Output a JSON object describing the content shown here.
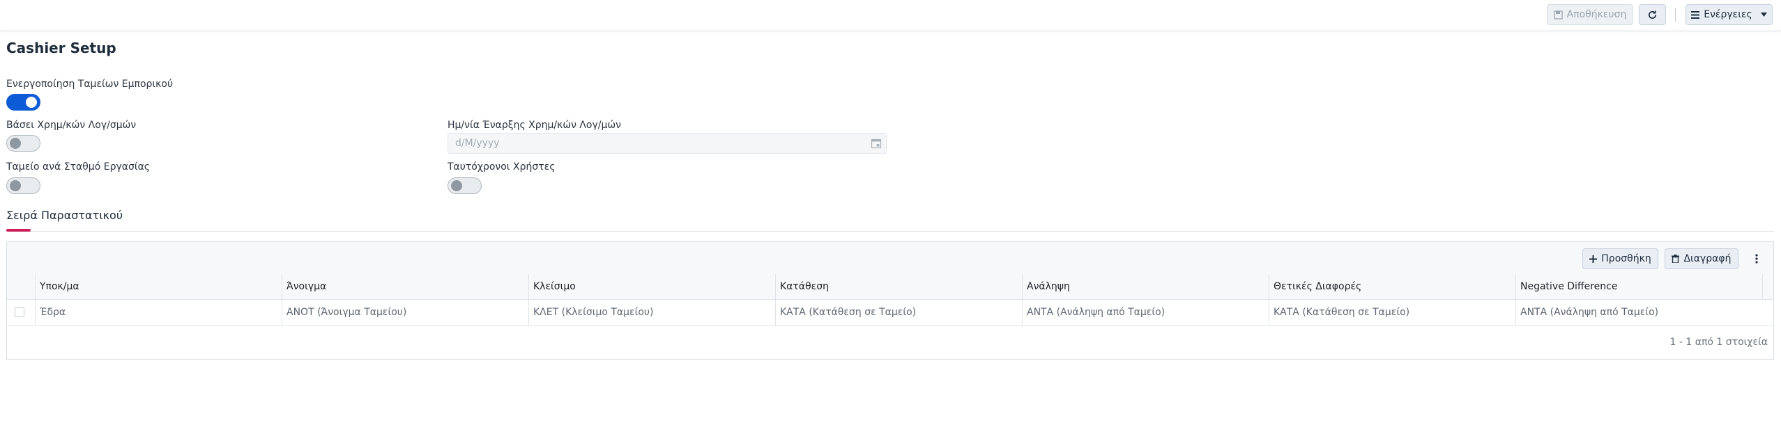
{
  "toolbar": {
    "save_label": "Αποθήκευση",
    "actions_label": "Ενέργειες"
  },
  "page": {
    "title": "Cashier Setup"
  },
  "form": {
    "enable_cashiers": {
      "label": "Ενεργοποίηση Ταμείων Εμπορικού",
      "on": true
    },
    "financial_years": {
      "label": "Βάσει Χρημ/κών Λογ/σμών",
      "on": false
    },
    "start_date": {
      "label": "Ημ/νία Έναρξης Χρημ/κών Λογ/μών",
      "placeholder": "d/M/yyyy"
    },
    "per_workstation": {
      "label": "Ταμείο ανά Σταθμό Εργασίας",
      "on": false
    },
    "concurrent_users": {
      "label": "Ταυτόχρονοι Χρήστες",
      "on": false
    }
  },
  "section": {
    "tab_label": "Σειρά Παραστατικού"
  },
  "grid": {
    "add_label": "Προσθήκη",
    "delete_label": "Διαγραφή",
    "columns": [
      "Υποκ/μα",
      "Άνοιγμα",
      "Κλείσιμο",
      "Κατάθεση",
      "Ανάληψη",
      "Θετικές Διαφορές",
      "Negative Difference"
    ],
    "rows": [
      [
        "Έδρα",
        "ΑΝΟΤ (Άνοιγμα Ταμείου)",
        "ΚΛΕΤ (Κλείσιμο Ταμείου)",
        "ΚΑΤΑ (Κατάθεση σε Ταμείο)",
        "ΑΝΤΑ (Ανάληψη από Ταμείο)",
        "ΚΑΤΑ (Κατάθεση σε Ταμείο)",
        "ΑΝΤΑ (Ανάληψη από Ταμείο)"
      ]
    ],
    "pager": "1 - 1 από 1 στοιχεία"
  },
  "colors": {
    "toggle_on": "#0d5bd7",
    "tab_accent": "#cc1f5a"
  }
}
